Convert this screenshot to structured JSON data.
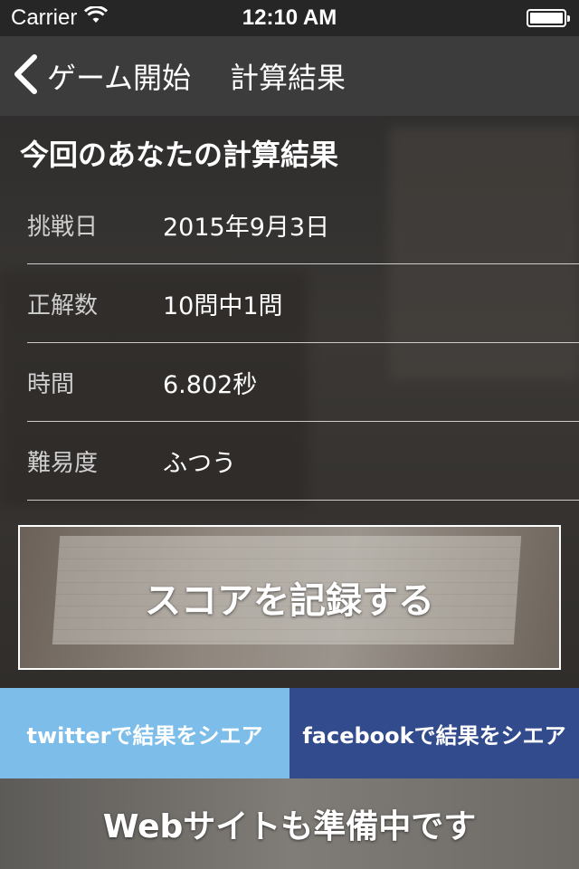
{
  "status_bar": {
    "carrier": "Carrier",
    "time": "12:10 AM",
    "battery_percent": 100
  },
  "nav": {
    "back_label": "ゲーム開始",
    "title": "計算結果"
  },
  "result": {
    "heading": "今回のあなたの計算結果",
    "rows": [
      {
        "label": "挑戦日",
        "value": "2015年9月3日"
      },
      {
        "label": "正解数",
        "value": "10問中1問"
      },
      {
        "label": "時間",
        "value": "6.802秒"
      },
      {
        "label": "難易度",
        "value": "ふつう"
      }
    ]
  },
  "record_button": {
    "label": "スコアを記録する"
  },
  "share": {
    "twitter_label": "twitterで結果をシエア",
    "facebook_label": "facebookで結果をシエア",
    "twitter_color": "#7dbde9",
    "facebook_color": "#324b8c"
  },
  "footer": {
    "text": "Webサイトも準備中です"
  }
}
